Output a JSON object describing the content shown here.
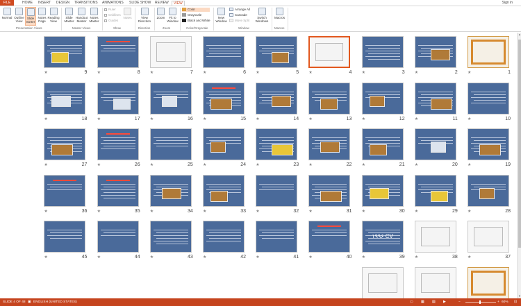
{
  "tabs": [
    "FILE",
    "HOME",
    "INSERT",
    "DESIGN",
    "TRANSITIONS",
    "ANIMATIONS",
    "SLIDE SHOW",
    "REVIEW",
    "VIEW"
  ],
  "active_tab": "VIEW",
  "signin": "Sign in",
  "ribbon": {
    "presentation_views": {
      "label": "Presentation Views",
      "normal": "Normal",
      "outline": "Outline View",
      "slide_sorter": "Slide Sorter",
      "notes_page": "Notes Page",
      "reading_view": "Reading View"
    },
    "master_views": {
      "label": "Master Views",
      "slide_master": "Slide Master",
      "handout_master": "Handout Master",
      "notes_master": "Notes Master"
    },
    "show": {
      "label": "Show",
      "ruler": "Ruler",
      "gridlines": "Gridlines",
      "guides": "Guides",
      "notes": "Notes"
    },
    "direction": {
      "label": "Direction",
      "view_direction": "View Direction"
    },
    "zoom": {
      "label": "Zoom",
      "zoom": "Zoom",
      "fit": "Fit to Window"
    },
    "color": {
      "label": "Color/Grayscale",
      "color": "Color",
      "grayscale": "Grayscale",
      "bw": "Black and White"
    },
    "window": {
      "label": "Window",
      "new_window": "New Window",
      "arrange_all": "Arrange All",
      "cascade": "Cascade",
      "move_split": "Move Split",
      "switch_windows": "Switch Windows"
    },
    "macros": {
      "label": "Macros",
      "macros": "Macros"
    }
  },
  "slides": {
    "numbers": [
      1,
      2,
      3,
      4,
      5,
      6,
      7,
      8,
      9,
      10,
      11,
      12,
      13,
      14,
      15,
      16,
      17,
      18,
      19,
      20,
      21,
      22,
      23,
      24,
      25,
      26,
      27,
      28,
      29,
      30,
      31,
      32,
      33,
      34,
      35,
      36,
      37,
      38,
      39,
      40,
      41,
      42,
      43,
      44,
      45,
      46,
      47,
      48
    ],
    "selected": 4,
    "texts": {
      "39": "۱۹۹۶ CV"
    }
  },
  "status": {
    "slide_indicator": "SLIDE 4 OF 48",
    "language": "ENGLISH (UNITED STATES)",
    "zoom": "60%"
  },
  "colors": {
    "accent": "#d04a20",
    "statusbar": "#c5441e",
    "slide_bg": "#4a6a9a",
    "selection": "#e2581e"
  }
}
